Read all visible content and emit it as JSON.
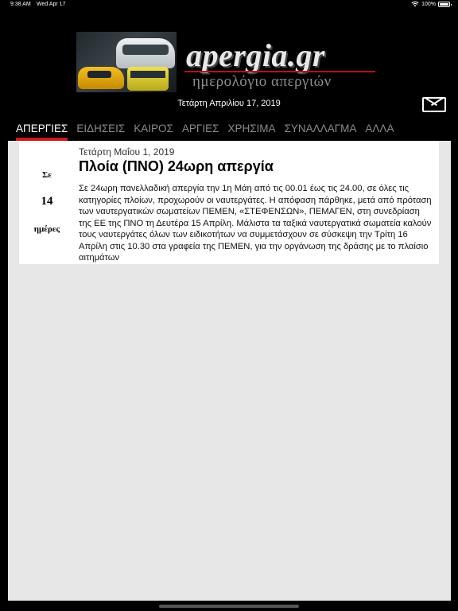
{
  "status_bar": {
    "time": "9:38 AM",
    "date": "Wed Apr 17",
    "battery": "100%",
    "battery_level": 1.0
  },
  "header": {
    "brand": "apergia.gr",
    "tagline": "ημερολόγιο απεργιών",
    "current_date": "Τετάρτη Απριλίου 17, 2019",
    "mail_icon": "mail-icon"
  },
  "tabs": [
    {
      "label": "ΑΠΕΡΓΙΕΣ",
      "active": true
    },
    {
      "label": "ΕΙΔΗΣΕΙΣ",
      "active": false
    },
    {
      "label": "ΚΑΙΡΟΣ",
      "active": false
    },
    {
      "label": "ΑΡΓΙΕΣ",
      "active": false
    },
    {
      "label": "ΧΡΗΣΙΜΑ",
      "active": false
    },
    {
      "label": "ΣΥΝΑΛΛΑΓΜΑ",
      "active": false
    },
    {
      "label": "ΑΛΛΑ",
      "active": false
    }
  ],
  "strike": {
    "countdown_prefix": "Σε",
    "countdown_days": "14",
    "countdown_suffix": "ημέρες",
    "date": "Τετάρτη Μαΐου 1, 2019",
    "title": "Πλοία (ΠΝΟ) 24ωρη απεργία",
    "body": "Σε 24ωρη πανελλαδική απεργία την 1η Μάη από τις 00.01 έως τις 24.00, σε όλες τις κατηγορίες πλοίων, προχωρούν οι ναυτεργάτες. Η απόφαση πάρθηκε, μετά από πρόταση των ναυτεργατικών σωματείων ΠΕΜΕΝ, «ΣΤΕΦΕΝΣΩΝ», ΠΕΜΑΓΕΝ, στη συνεδρίαση της ΕΕ της ΠΝΟ τη Δευτέρα 15 Απρίλη. Μάλιστα τα ταξικά ναυτεργατικά σωματεία καλούν τους ναυτεργάτες όλων των ειδικοτήτων να συμμετάσχουν σε σύσκεψη την Τρίτη 16 Απρίλη στις 10.30 στα γραφεία της ΠΕΜΕΝ, για την οργάνωση της δράσης με το πλαίσιο αιτημάτων"
  },
  "colors": {
    "accent": "#d0161f",
    "background": "#000000",
    "panel": "#e7e7e7"
  }
}
